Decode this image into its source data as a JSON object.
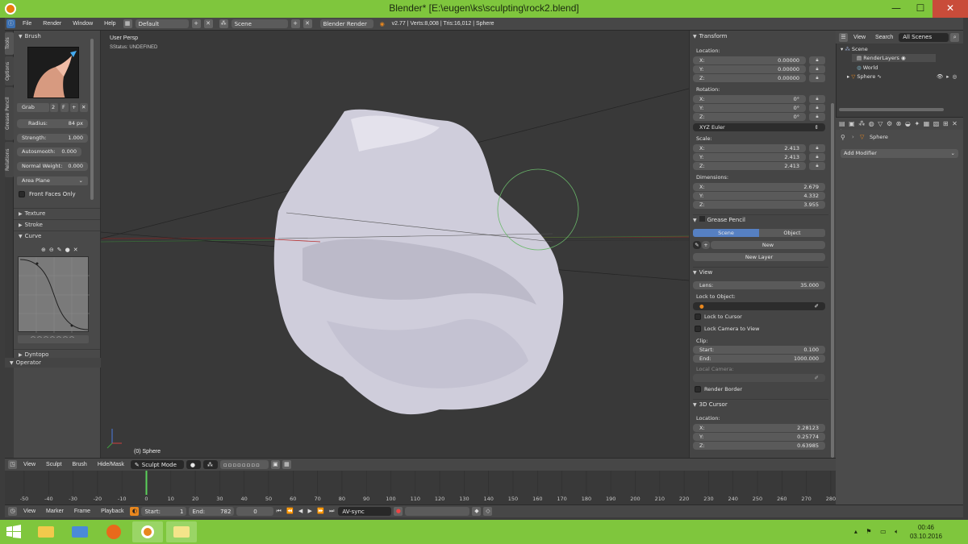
{
  "window": {
    "title": "Blender* [E:\\eugen\\ks\\sculpting\\rock2.blend]",
    "minimize": "—",
    "maximize": "☐",
    "close": "✕"
  },
  "infobar": {
    "menus": [
      "File",
      "Render",
      "Window",
      "Help"
    ],
    "layout": "Default",
    "scene": "Scene",
    "engine": "Blender Render",
    "stats": "v2.77 | Verts:8,008 | Tris:16,012 | Sphere"
  },
  "tabs": [
    "Tools",
    "Options",
    "Grease Pencil",
    "Relations"
  ],
  "toolshelf": {
    "brush_header": "Brush",
    "brush_name": "Grab",
    "brush_users": "2",
    "brush_fake": "F",
    "radius_label": "Radius:",
    "radius_value": "84 px",
    "strength_label": "Strength:",
    "strength_value": "1.000",
    "autosmooth_label": "Autosmooth:",
    "autosmooth_value": "0.000",
    "normal_weight_label": "Normal Weight:",
    "normal_weight_value": "0.000",
    "area_plane": "Area Plane",
    "front_faces": "Front Faces Only",
    "texture": "Texture",
    "stroke": "Stroke",
    "curve": "Curve",
    "dyntopo": "Dyntopo",
    "operator": "Operator"
  },
  "viewport": {
    "view_label": "User Persp",
    "status": "SStatus: UNDEFINED",
    "object_label": "(0) Sphere"
  },
  "npanel": {
    "transform": "Transform",
    "location": "Location:",
    "loc": [
      [
        "X:",
        "0.00000"
      ],
      [
        "Y:",
        "0.00000"
      ],
      [
        "Z:",
        "0.00000"
      ]
    ],
    "rotation": "Rotation:",
    "rot": [
      [
        "X:",
        "0°"
      ],
      [
        "Y:",
        "0°"
      ],
      [
        "Z:",
        "0°"
      ]
    ],
    "rot_mode": "XYZ Euler",
    "scale": "Scale:",
    "scl": [
      [
        "X:",
        "2.413"
      ],
      [
        "Y:",
        "2.413"
      ],
      [
        "Z:",
        "2.413"
      ]
    ],
    "dimensions": "Dimensions:",
    "dim": [
      [
        "X:",
        "2.679"
      ],
      [
        "Y:",
        "4.332"
      ],
      [
        "Z:",
        "3.955"
      ]
    ],
    "grease_pencil": "Grease Pencil",
    "gp_scene": "Scene",
    "gp_object": "Object",
    "gp_new": "New",
    "gp_new_layer": "New Layer",
    "view": "View",
    "lens_label": "Lens:",
    "lens_value": "35.000",
    "lock_to_object": "Lock to Object:",
    "lock_to_cursor": "Lock to Cursor",
    "lock_camera": "Lock Camera to View",
    "clip": "Clip:",
    "clip_start_label": "Start:",
    "clip_start": "0.100",
    "clip_end_label": "End:",
    "clip_end": "1000.000",
    "local_camera": "Local Camera:",
    "render_border": "Render Border",
    "cursor": "3D Cursor",
    "cursor_location": "Location:",
    "cur": [
      [
        "X:",
        "2.28123"
      ],
      [
        "Y:",
        "0.25774"
      ],
      [
        "Z:",
        "0.63985"
      ]
    ]
  },
  "outliner": {
    "view": "View",
    "search": "Search",
    "filter": "All Scenes",
    "items": [
      "Scene",
      "RenderLayers",
      "World",
      "Sphere"
    ]
  },
  "properties": {
    "object": "Sphere",
    "add_modifier": "Add Modifier"
  },
  "viewheader": {
    "menus": [
      "View",
      "Sculpt",
      "Brush",
      "Hide/Mask"
    ],
    "mode": "Sculpt Mode"
  },
  "timeline": {
    "ticks": [
      "-50",
      "-40",
      "-30",
      "-20",
      "-10",
      "0",
      "10",
      "20",
      "30",
      "40",
      "50",
      "60",
      "70",
      "80",
      "90",
      "100",
      "110",
      "120",
      "130",
      "140",
      "150",
      "160",
      "170",
      "180",
      "190",
      "200",
      "210",
      "220",
      "230",
      "240",
      "250",
      "260",
      "270",
      "280"
    ],
    "current_frame": 0,
    "menus": [
      "View",
      "Marker",
      "Frame",
      "Playback"
    ],
    "start_label": "Start:",
    "start": "1",
    "end_label": "End:",
    "end": "782",
    "frame": "0",
    "sync": "AV-sync"
  },
  "taskbar": {
    "time": "00:46",
    "date": "03.10.2016"
  },
  "colors": {
    "accent": "#7fc63d",
    "selected": "#5680c2",
    "mesh": "#d8d6e4"
  }
}
